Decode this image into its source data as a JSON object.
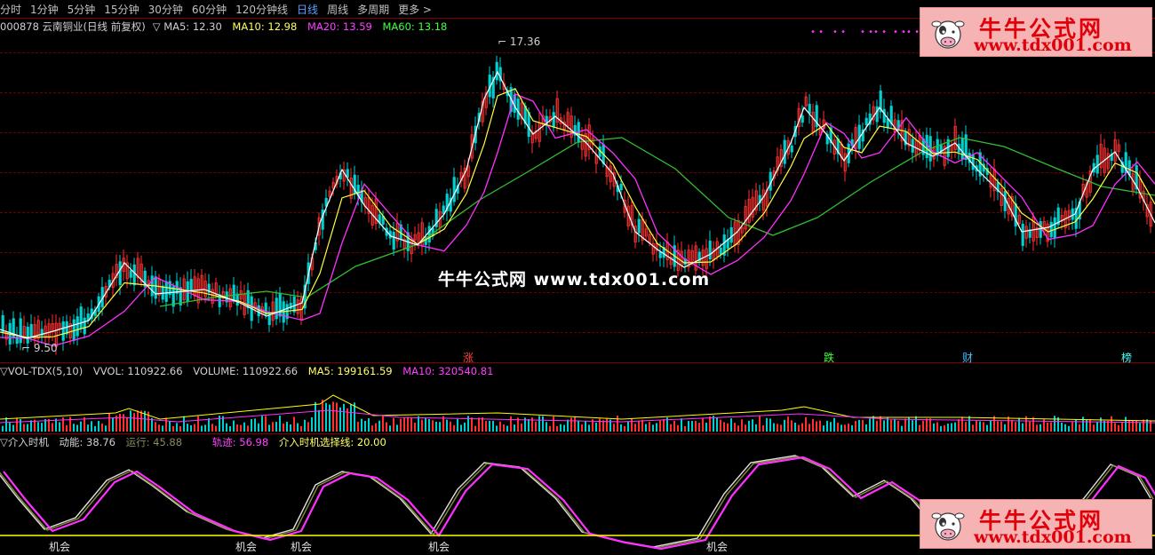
{
  "toolbar": {
    "tabs": [
      "分时",
      "1分钟",
      "5分钟",
      "15分钟",
      "30分钟",
      "60分钟",
      "120分钟线",
      "日线",
      "周线",
      "多周期",
      "更多 >"
    ],
    "active_index": 7
  },
  "main_chart": {
    "stock": "000878 云南铜业(日线 前复权)",
    "indicator_marker": "▽",
    "ma5": "MA5: 12.30",
    "ma10": "MA10: 12.98",
    "ma20": "MA20: 13.59",
    "ma60": "MA60: 13.18",
    "high_label": "17.36",
    "low_label": "9.50",
    "event_marks": [
      "涨",
      "跌",
      "财",
      "榜"
    ],
    "watermark": "牛牛公式网  www.tdx001.com"
  },
  "volume_panel": {
    "name": "▽VOL-TDX(5,10)",
    "vvol": "VVOL: 110922.66",
    "volume": "VOLUME: 110922.66",
    "ma5": "MA5: 199161.59",
    "ma10": "MA10: 320540.81"
  },
  "indicator_panel": {
    "name": "▽介入时机",
    "dongneng": "动能: 38.76",
    "yunxing": "运行: 45.88",
    "guiji": "轨迹: 56.98",
    "select_line": "介入时机选择线: 20.00",
    "chance_labels": [
      "机会",
      "机会",
      "机会",
      "机会",
      "机会"
    ]
  },
  "logo": {
    "title": "牛牛公式网",
    "url": "www.tdx001.com",
    "icon": "cow-icon"
  },
  "colors": {
    "up": "#ff3030",
    "down": "#00d0d0",
    "ma5": "#ffffff",
    "ma10": "#ffff40",
    "ma20": "#ff30ff",
    "ma60": "#30c030",
    "accent": "#5aa0ff",
    "line_yellow": "#ffff00"
  }
}
